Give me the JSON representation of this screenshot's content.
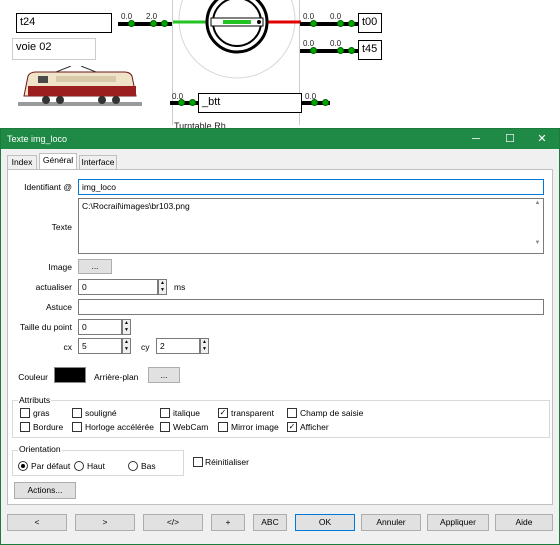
{
  "track_plan": {
    "block_t24": "t24",
    "block_voie02": "voie 02",
    "block_btt": "_btt",
    "block_t00": "t00",
    "block_t45": "t45",
    "counter": "0.0",
    "counter2": "2.0",
    "partial_label": "Turntable Rh..."
  },
  "dialog": {
    "title": "Texte img_loco",
    "tabs": [
      "Index",
      "Général",
      "Interface"
    ],
    "identifiant_label": "Identifiant @",
    "identifiant_value": "img_loco",
    "texte_label": "Texte",
    "texte_value": "C:\\Rocrail\\images\\br103.png",
    "image_label": "Image",
    "image_button": "...",
    "actualiser_label": "actualiser",
    "actualiser_value": "0",
    "actualiser_unit": "ms",
    "astuce_label": "Astuce",
    "astuce_value": "",
    "taille_label": "Taille du point",
    "taille_value": "0",
    "cx_label": "cx",
    "cx_value": "5",
    "cy_label": "cy",
    "cy_value": "2",
    "couleur_label": "Couleur",
    "couleur_color": "#000000",
    "arriere_label": "Arrière-plan",
    "arriere_button": "...",
    "attributs_title": "Attributs",
    "attributs": [
      {
        "label": "gras",
        "checked": false
      },
      {
        "label": "souligné",
        "checked": false
      },
      {
        "label": "italique",
        "checked": false
      },
      {
        "label": "transparent",
        "checked": true
      },
      {
        "label": "Champ de saisie",
        "checked": false
      },
      {
        "label": "Bordure",
        "checked": false
      },
      {
        "label": "Horloge accélérée",
        "checked": false
      },
      {
        "label": "WebCam",
        "checked": false
      },
      {
        "label": "Mirror image",
        "checked": false
      },
      {
        "label": "Afficher",
        "checked": true
      }
    ],
    "orientation_title": "Orientation",
    "orientation": [
      {
        "label": "Par défaut",
        "selected": true
      },
      {
        "label": "Haut",
        "selected": false
      },
      {
        "label": "Bas",
        "selected": false
      }
    ],
    "reinitialiser_label": "Réinitialiser",
    "actions_button": "Actions...",
    "bottom_buttons": [
      "<",
      ">",
      "</>",
      "+",
      "ABC",
      "OK",
      "Annuler",
      "Appliquer",
      "Aide"
    ],
    "window_controls": {
      "minimize": "─",
      "maximize": "☐",
      "close": "✕"
    }
  }
}
